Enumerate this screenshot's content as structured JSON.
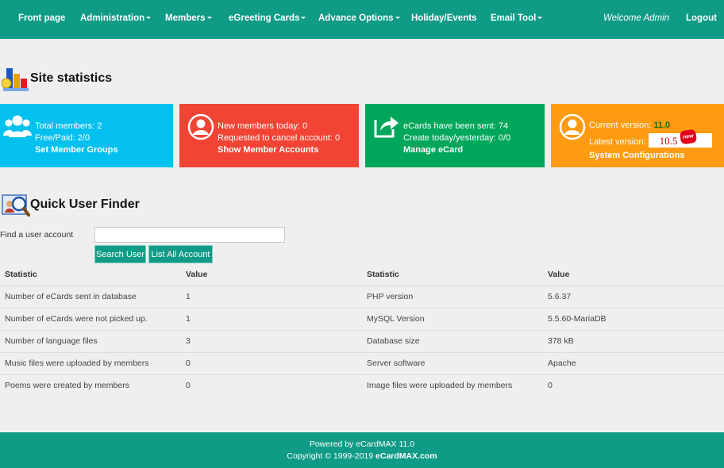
{
  "nav": {
    "items": [
      {
        "label": "Front page",
        "dropdown": false
      },
      {
        "label": "Administration",
        "dropdown": true
      },
      {
        "label": "Members",
        "dropdown": true
      },
      {
        "label": "eGreeting Cards",
        "dropdown": true
      },
      {
        "label": "Advance Options",
        "dropdown": true
      },
      {
        "label": "Holiday/Events",
        "dropdown": false
      },
      {
        "label": "Email Tool",
        "dropdown": true
      }
    ],
    "welcome": "Welcome Admin",
    "logout": "Logout"
  },
  "site_stats": {
    "title": "Site statistics",
    "boxes": {
      "members": {
        "color": "#03c0ef",
        "icon": "users-icon",
        "line1": "Total members: 2",
        "line2": "Free/Paid: 2/0",
        "link": "Set Member Groups"
      },
      "new_members": {
        "color": "#f14434",
        "icon": "user-circle-icon",
        "line1": "New members today: 0",
        "line2": "Requested to cancel account: 0",
        "link": "Show Member Accounts"
      },
      "ecards": {
        "color": "#00a65a",
        "icon": "share-icon",
        "line1": "eCards have been sent: 74",
        "line2": "Create today/yesterday: 0/0",
        "link": "Manage eCard"
      },
      "version": {
        "color": "#fe9b10",
        "icon": "user-circle-icon",
        "current_label": "Current version: ",
        "current_value": "11.0",
        "latest_label": "Latest version: ",
        "latest_value": "10.5",
        "new_badge": "new",
        "link": "System Configurations"
      }
    }
  },
  "finder": {
    "title": "Quick User Finder",
    "label": "Find a user account",
    "input_value": "",
    "search_button": "Search User",
    "list_button": "List All Account"
  },
  "table": {
    "headers": [
      "Statistic",
      "Value",
      "Statistic",
      "Value"
    ],
    "rows": [
      [
        "Number of eCards sent in database",
        "1",
        "PHP version",
        "5.6.37"
      ],
      [
        "Number of eCards were not picked up.",
        "1",
        "MySQL Version",
        "5.5.60-MariaDB"
      ],
      [
        "Number of language files",
        "3",
        "Database size",
        "378 kB"
      ],
      [
        "Music files were uploaded by members",
        "0",
        "Server software",
        "Apache"
      ],
      [
        "Poems were created by members",
        "0",
        "Image files were uploaded by members",
        "0"
      ]
    ]
  },
  "footer": {
    "line1": "Powered by eCardMAX 11.0",
    "line2_prefix": "Copyright © 1999-2019 ",
    "line2_brand": "eCardMAX.com"
  },
  "colors": {
    "primary": "#0f9b86",
    "background": "#efefef"
  }
}
